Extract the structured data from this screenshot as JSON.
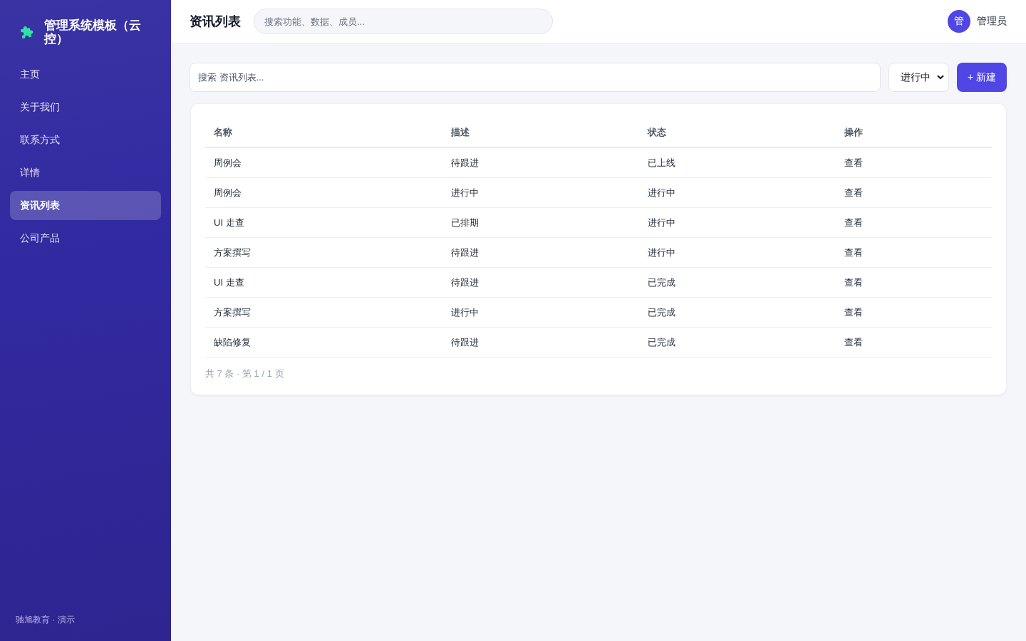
{
  "sidebar": {
    "brand": "管理系统模板（云控）",
    "items": [
      {
        "label": "主页",
        "selected": false
      },
      {
        "label": "关于我们",
        "selected": false
      },
      {
        "label": "联系方式",
        "selected": false
      },
      {
        "label": "详情",
        "selected": false
      },
      {
        "label": "资讯列表",
        "selected": true
      },
      {
        "label": "公司产品",
        "selected": false
      }
    ],
    "footer": "驰旭教育 · 演示"
  },
  "header": {
    "title": "资讯列表",
    "search": {
      "placeholder": "搜索功能、数据、成员..."
    },
    "user": {
      "avatar": "管",
      "name": "管理员"
    }
  },
  "toolbar": {
    "search": {
      "placeholder": "搜索 资讯列表..."
    },
    "filter": {
      "value": "进行中"
    },
    "new_button": "+ 新建"
  },
  "table": {
    "columns": [
      "名称",
      "描述",
      "状态",
      "操作"
    ],
    "rows": [
      [
        "周例会",
        "待跟进",
        "已上线",
        "查看"
      ],
      [
        "周例会",
        "进行中",
        "进行中",
        "查看"
      ],
      [
        "UI 走查",
        "已排期",
        "进行中",
        "查看"
      ],
      [
        "方案撰写",
        "待跟进",
        "进行中",
        "查看"
      ],
      [
        "UI 走查",
        "待跟进",
        "已完成",
        "查看"
      ],
      [
        "方案撰写",
        "进行中",
        "已完成",
        "查看"
      ],
      [
        "缺陷修复",
        "待跟进",
        "已完成",
        "查看"
      ]
    ],
    "pagination": "共 7 条 · 第 1 / 1 页"
  }
}
